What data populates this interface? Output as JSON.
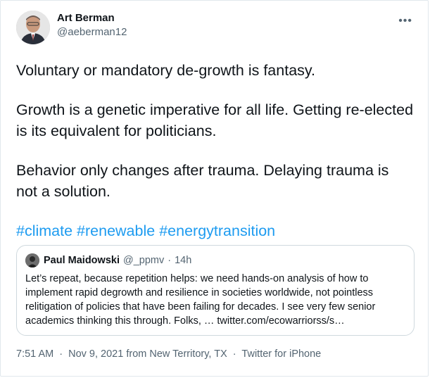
{
  "author": {
    "name": "Art Berman",
    "handle": "@aeberman12"
  },
  "more_icon": "more-horizontal-icon",
  "tweet": {
    "paragraphs": [
      "Voluntary or mandatory de-growth is fantasy.",
      "Growth is a genetic imperative for all life. Getting re-elected is its equivalent for politicians.",
      "Behavior only changes after trauma. Delaying trauma is not a solution."
    ],
    "hashtags": [
      "#climate",
      "#renewable",
      "#energytransition"
    ]
  },
  "quoted": {
    "name": "Paul Maidowski",
    "handle": "@_ppmv",
    "separator": "·",
    "time": "14h",
    "text": "Let’s repeat, because repetition helps: we need hands-on analysis of how to implement rapid degrowth and resilience in societies worldwide, not pointless relitigation of policies that have been failing for decades. I see very few senior academics thinking this through. Folks, … twitter.com/ecowarriorss/s…"
  },
  "footer": {
    "time": "7:51 AM",
    "date": "Nov 9, 2021",
    "location": "from New Territory, TX",
    "source": "Twitter for iPhone",
    "separator": "·"
  },
  "colors": {
    "link": "#1d9bf0",
    "secondary_text": "#536471",
    "primary_text": "#0f1419",
    "border": "#cfd9de"
  }
}
